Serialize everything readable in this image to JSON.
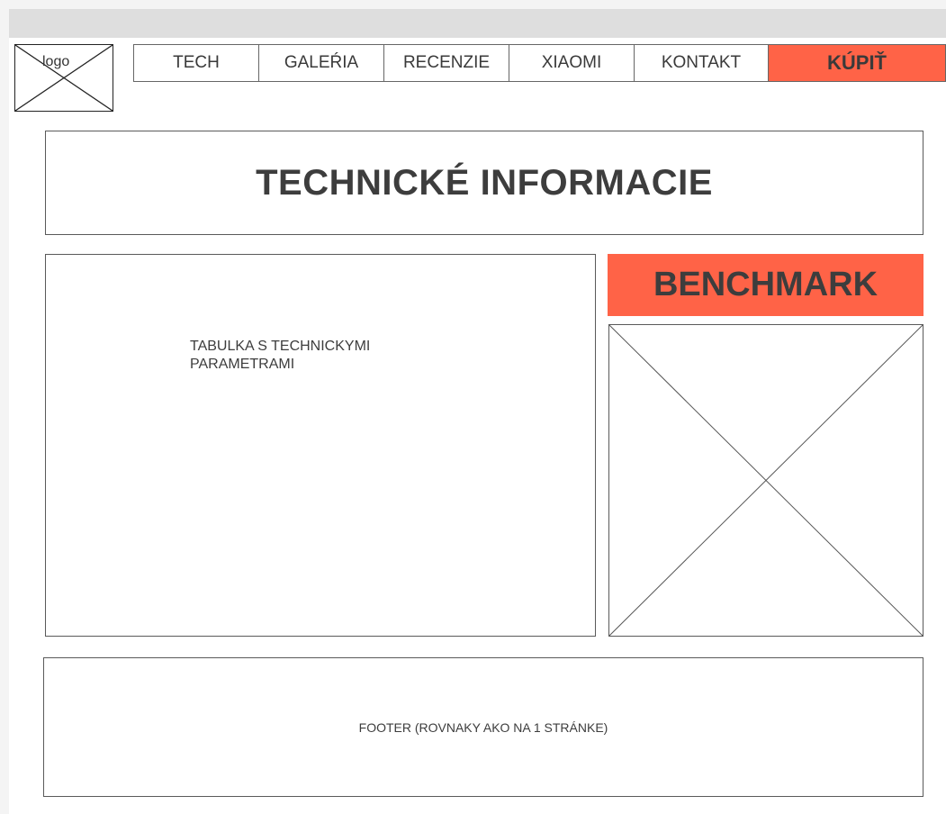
{
  "logo": {
    "label": "logo"
  },
  "nav": {
    "items": [
      "TECH",
      "GALEŔIA",
      "RECENZIE",
      "XIAOMI",
      "KONTAKT"
    ],
    "buy_label": "KÚPIŤ"
  },
  "title": "TECHNICKÉ INFORMACIE",
  "table_placeholder": "TABULKA S TECHNICKYMI PARAMETRAMI",
  "benchmark": {
    "label": "BENCHMARK"
  },
  "footer": "FOOTER (ROVNAKY AKO NA 1 STRÁNKE)",
  "colors": {
    "accent": "#ff6347",
    "text": "#3d3d3d",
    "border": "#5a5a5a"
  }
}
